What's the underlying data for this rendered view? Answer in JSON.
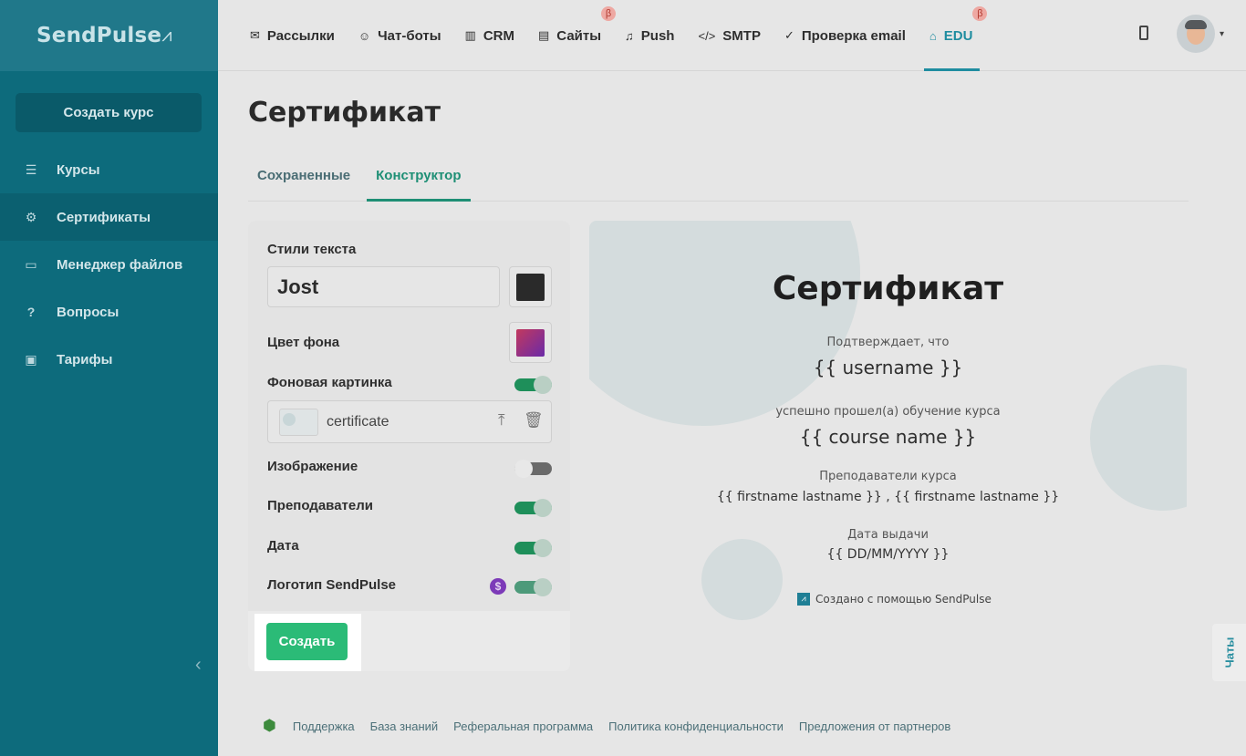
{
  "sidebar": {
    "logo": "SendPulse",
    "logo_mark": "⩘",
    "create_button": "Создать курс",
    "items": [
      {
        "icon": "courses-icon",
        "glyph": "☰",
        "label": "Курсы"
      },
      {
        "icon": "gear-icon",
        "glyph": "⚙",
        "label": "Сертификаты"
      },
      {
        "icon": "folder-icon",
        "glyph": "▭",
        "label": "Менеджер файлов"
      },
      {
        "icon": "question-icon",
        "glyph": "?",
        "label": "Вопросы"
      },
      {
        "icon": "wallet-icon",
        "glyph": "▣",
        "label": "Тарифы"
      }
    ],
    "collapse_glyph": "‹"
  },
  "topnav": {
    "items": [
      {
        "icon": "mail-icon",
        "glyph": "✉",
        "label": "Рассылки"
      },
      {
        "icon": "chatbot-icon",
        "glyph": "☺",
        "label": "Чат-боты"
      },
      {
        "icon": "crm-icon",
        "glyph": "▥",
        "label": "CRM"
      },
      {
        "icon": "sites-icon",
        "glyph": "▤",
        "label": "Сайты",
        "badge": "β"
      },
      {
        "icon": "bell-icon",
        "glyph": "♫",
        "label": "Push"
      },
      {
        "icon": "code-icon",
        "glyph": "</>",
        "label": "SMTP"
      },
      {
        "icon": "check-icon",
        "glyph": "✓",
        "label": "Проверка email"
      },
      {
        "icon": "edu-icon",
        "glyph": "⌂",
        "label": "EDU",
        "badge": "β"
      }
    ],
    "avatar_caret": "▾"
  },
  "page": {
    "title": "Сертификат",
    "tabs": [
      "Сохраненные",
      "Конструктор"
    ]
  },
  "panel": {
    "text_styles_label": "Стили текста",
    "font_value": "Jost",
    "text_color": "#2a2a2a",
    "bg_color_label": "Цвет фона",
    "bg_gradient_start": "#c2395e",
    "bg_gradient_end": "#6a2aa8",
    "bg_image_label": "Фоновая картинка",
    "bg_image_file": "certificate",
    "upload_glyph": "⤒",
    "delete_glyph": "🗑",
    "image_label": "Изображение",
    "teachers_label": "Преподаватели",
    "date_label": "Дата",
    "logo_label": "Логотип SendPulse",
    "dollar_glyph": "$",
    "create_button": "Создать"
  },
  "preview": {
    "title": "Сертификат",
    "confirms": "Подтверждает, что",
    "username": "{{ username }}",
    "completed": "успешно прошел(а) обучение курса",
    "course_name": "{{ course name }}",
    "teachers_title": "Преподаватели курса",
    "teachers": "{{ firstname lastname }} , {{ firstname lastname }}",
    "date_title": "Дата выдачи",
    "date": "{{ DD/MM/YYYY }}",
    "footer": "Создано с помощью SendPulse"
  },
  "chats_label": "Чаты",
  "footer": {
    "apple_glyph": "",
    "android_glyph": "⬢",
    "links": [
      "Поддержка",
      "База знаний",
      "Реферальная программа",
      "Политика конфиденциальности",
      "Предложения от партнеров"
    ]
  }
}
